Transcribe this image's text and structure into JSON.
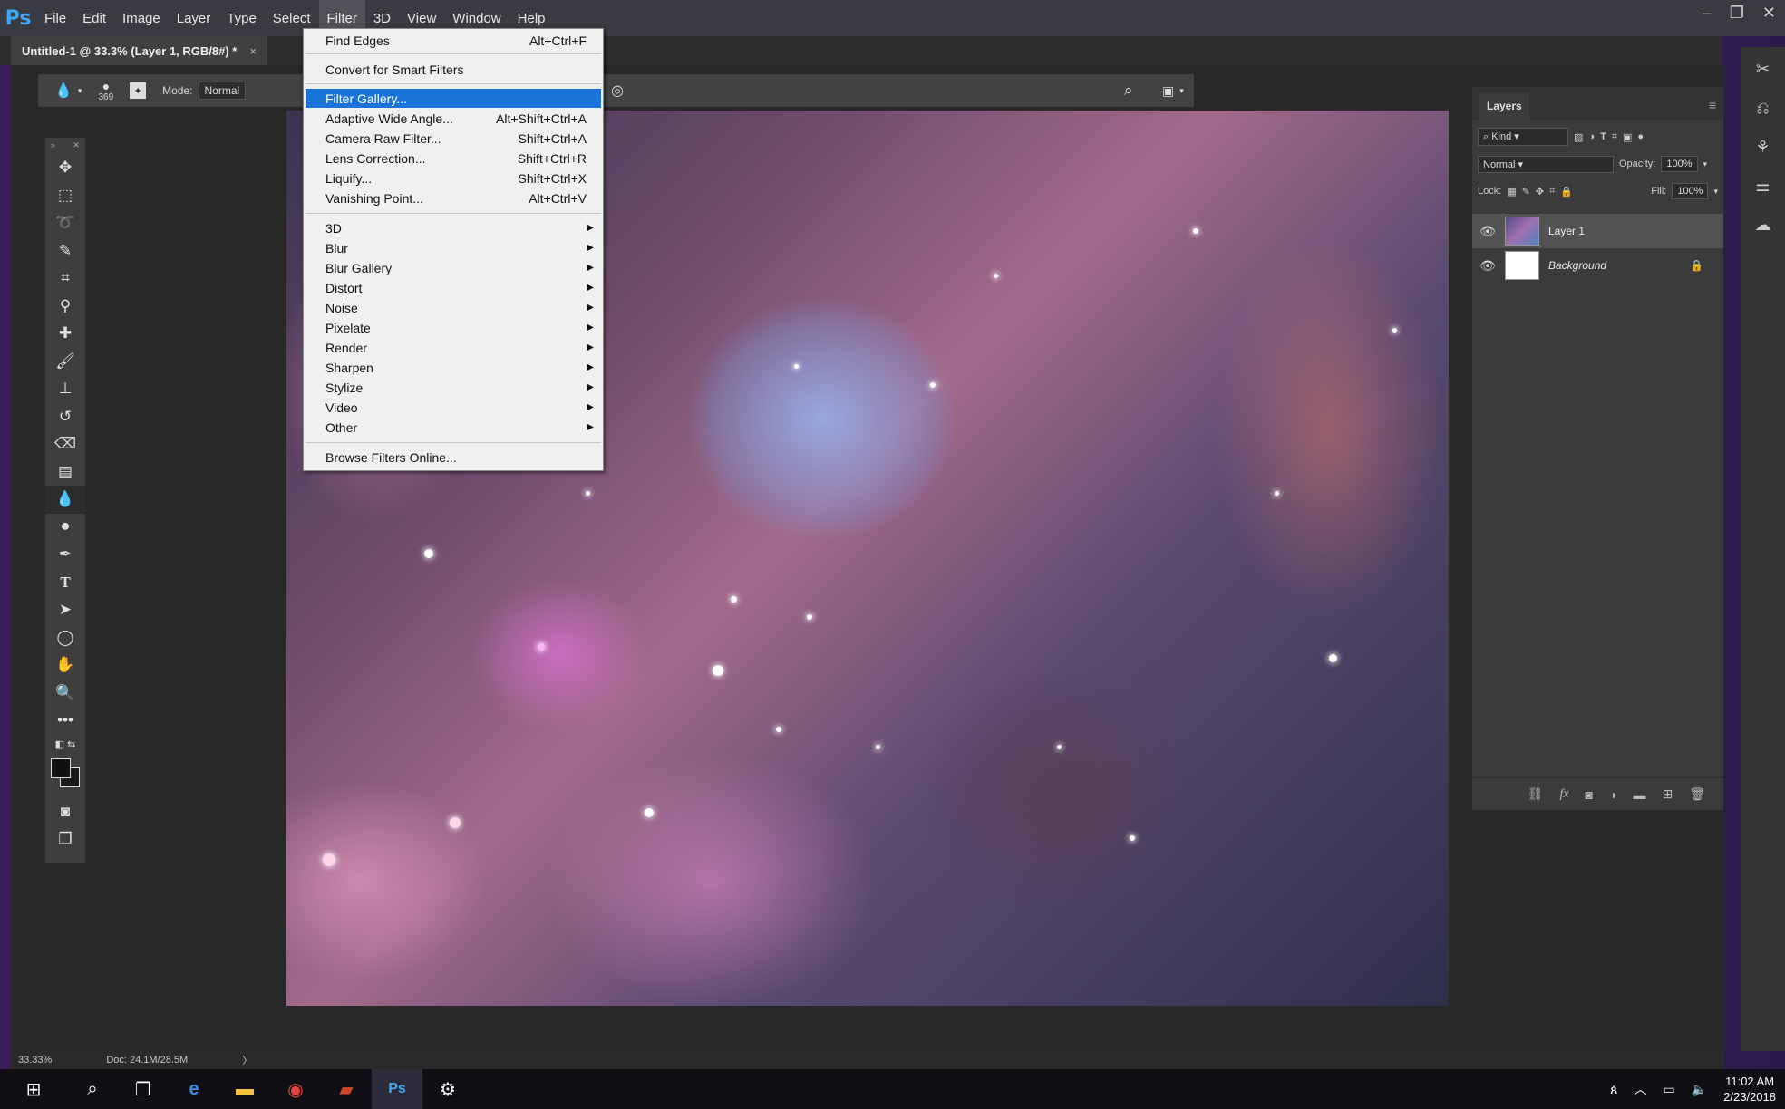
{
  "app": {
    "logo": "Ps"
  },
  "menu": [
    "File",
    "Edit",
    "Image",
    "Layer",
    "Type",
    "Select",
    "Filter",
    "3D",
    "View",
    "Window",
    "Help"
  ],
  "window_controls": {
    "minimize": "–",
    "restore": "❐",
    "close": "✕"
  },
  "document": {
    "tab_title": "Untitled-1 @ 33.3% (Layer 1, RGB/8#) *",
    "close": "×"
  },
  "options_bar": {
    "brush_size": "369",
    "mode_label": "Mode:",
    "mode_value": "Normal"
  },
  "filter_menu": {
    "top": [
      {
        "label": "Find Edges",
        "shortcut": "Alt+Ctrl+F"
      },
      {
        "label": "Convert for Smart Filters",
        "shortcut": ""
      }
    ],
    "filters": [
      {
        "label": "Filter Gallery...",
        "shortcut": ""
      },
      {
        "label": "Adaptive Wide Angle...",
        "shortcut": "Alt+Shift+Ctrl+A"
      },
      {
        "label": "Camera Raw Filter...",
        "shortcut": "Shift+Ctrl+A"
      },
      {
        "label": "Lens Correction...",
        "shortcut": "Shift+Ctrl+R"
      },
      {
        "label": "Liquify...",
        "shortcut": "Shift+Ctrl+X"
      },
      {
        "label": "Vanishing Point...",
        "shortcut": "Alt+Ctrl+V"
      }
    ],
    "submenus": [
      "3D",
      "Blur",
      "Blur Gallery",
      "Distort",
      "Noise",
      "Pixelate",
      "Render",
      "Sharpen",
      "Stylize",
      "Video",
      "Other"
    ],
    "bottom": "Browse Filters Online..."
  },
  "layers_panel": {
    "tab": "Layers",
    "kind_label": "Kind",
    "blend_mode": "Normal",
    "opacity_label": "Opacity:",
    "opacity_value": "100%",
    "lock_label": "Lock:",
    "fill_label": "Fill:",
    "fill_value": "100%",
    "layers": [
      {
        "name": "Layer 1",
        "active": true
      },
      {
        "name": "Background",
        "active": false
      }
    ]
  },
  "status": {
    "zoom": "33.33%",
    "doc": "Doc: 24.1M/28.5M",
    "arrow": "〉"
  },
  "taskbar": {
    "time": "11:02 AM",
    "date": "2/23/2018",
    "ps_label": "Ps"
  },
  "colors": {
    "highlight": "#1a73d9",
    "ps_blue": "#3fa9f5"
  }
}
